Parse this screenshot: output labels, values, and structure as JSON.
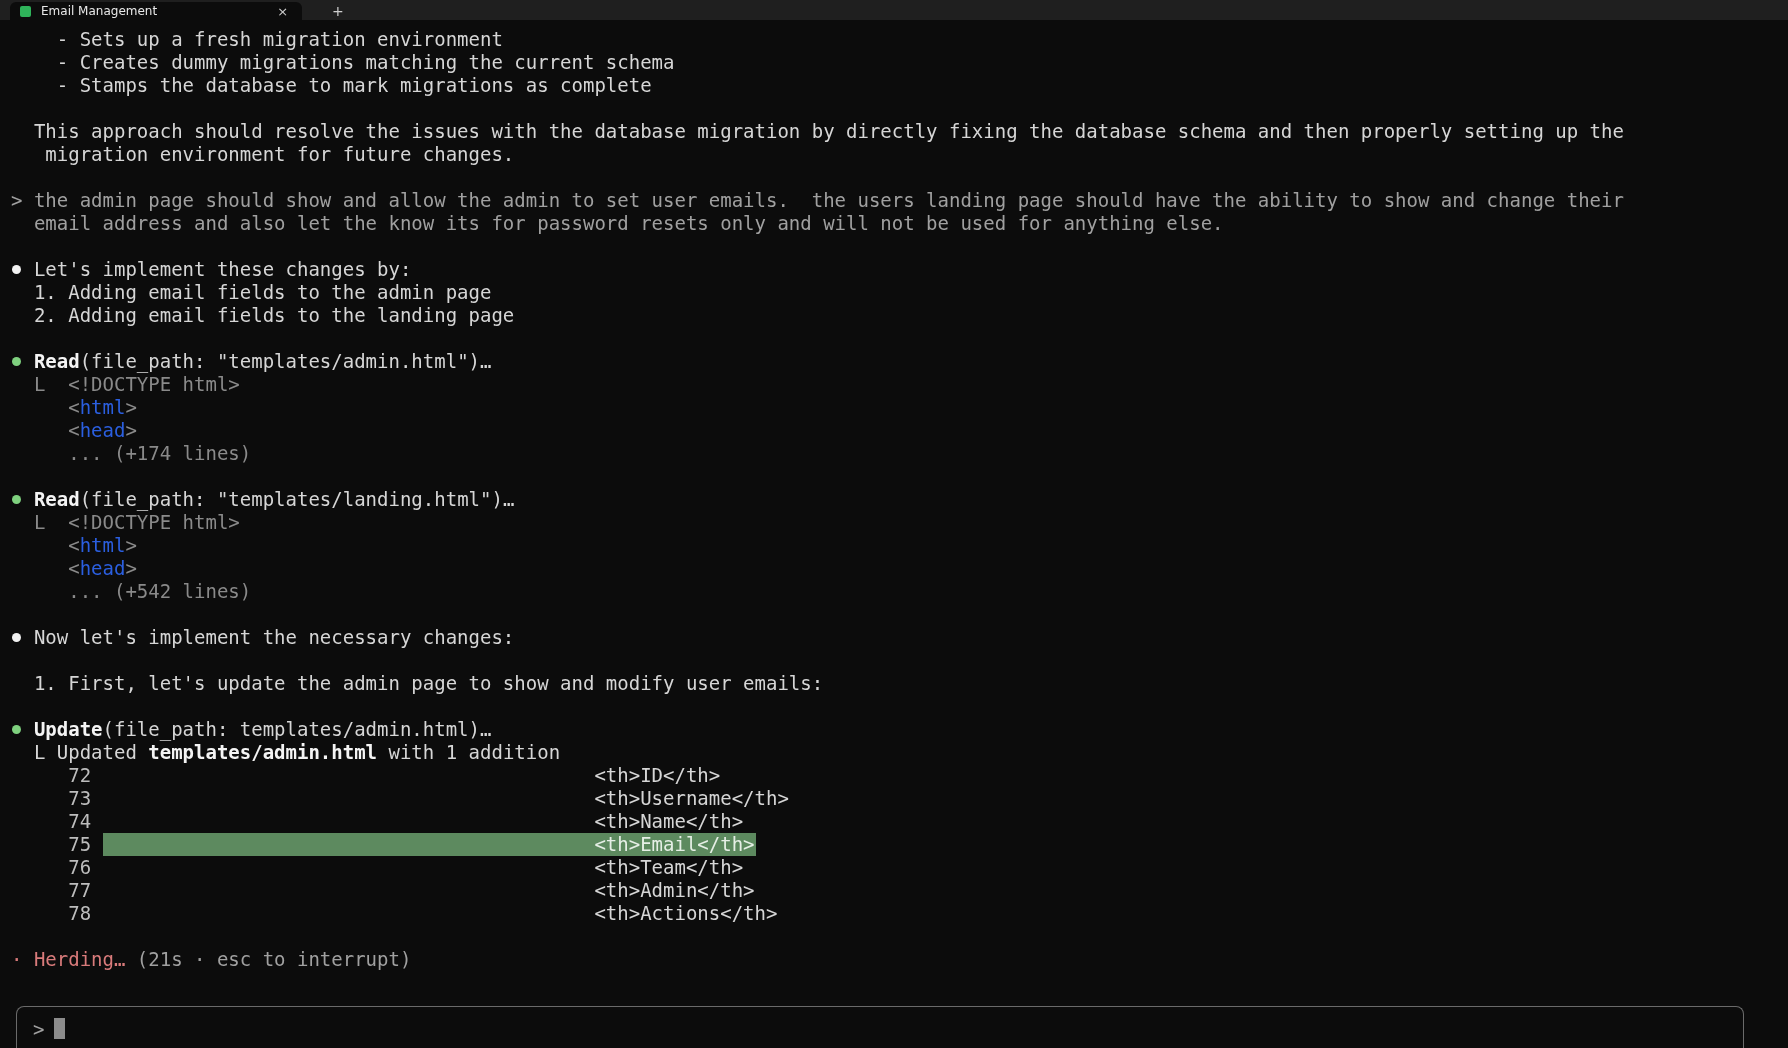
{
  "tab": {
    "title": "Email Management",
    "close": "×",
    "new_tab": "+"
  },
  "transcript": [
    {
      "kind": "list",
      "text": "- Sets up a fresh migration environment"
    },
    {
      "kind": "list",
      "text": "- Creates dummy migrations matching the current schema"
    },
    {
      "kind": "list",
      "text": "- Stamps the database to mark migrations as complete"
    },
    {
      "kind": "gap"
    },
    {
      "kind": "para",
      "text": "This approach should resolve the issues with the database migration by directly fixing the database schema and then properly setting up the"
    },
    {
      "kind": "para",
      "text": " migration environment for future changes."
    },
    {
      "kind": "gap"
    },
    {
      "kind": "user",
      "prompt": ">",
      "text": "the admin page should show and allow the admin to set user emails.  the users landing page should have the ability to show and change their"
    },
    {
      "kind": "user",
      "text": "email address and also let the know its for password resets only and will not be used for anything else."
    },
    {
      "kind": "gap"
    },
    {
      "kind": "bullet",
      "color": "#f2f2f2",
      "text": "Let's implement these changes by:"
    },
    {
      "kind": "para",
      "text": "1. Adding email fields to the admin page"
    },
    {
      "kind": "para",
      "text": "2. Adding email fields to the landing page"
    },
    {
      "kind": "gap"
    },
    {
      "kind": "bullet",
      "color": "#7fd17f",
      "text": "**Read**(file_path: \"templates/admin.html\")…"
    },
    {
      "kind": "output",
      "text": "L  <!DOCTYPE html>"
    },
    {
      "kind": "code",
      "parts": [
        {
          "kind": "plain",
          "text": "<"
        },
        {
          "kind": "tag",
          "text": "html"
        },
        {
          "kind": "plain",
          "text": ">"
        }
      ]
    },
    {
      "kind": "code",
      "parts": [
        {
          "kind": "plain",
          "text": "<"
        },
        {
          "kind": "tag",
          "text": "head"
        },
        {
          "kind": "plain",
          "text": ">"
        }
      ]
    },
    {
      "kind": "code",
      "parts": [
        {
          "kind": "plain",
          "text": "... (+174 lines)"
        }
      ]
    },
    {
      "kind": "gap"
    },
    {
      "kind": "bullet",
      "color": "#7fd17f",
      "text": "**Read**(file_path: \"templates/landing.html\")…"
    },
    {
      "kind": "output",
      "text": "L  <!DOCTYPE html>"
    },
    {
      "kind": "code",
      "parts": [
        {
          "kind": "plain",
          "text": "<"
        },
        {
          "kind": "tag",
          "text": "html"
        },
        {
          "kind": "plain",
          "text": ">"
        }
      ]
    },
    {
      "kind": "code",
      "parts": [
        {
          "kind": "plain",
          "text": "<"
        },
        {
          "kind": "tag",
          "text": "head"
        },
        {
          "kind": "plain",
          "text": ">"
        }
      ]
    },
    {
      "kind": "code",
      "parts": [
        {
          "kind": "plain",
          "text": "... (+542 lines)"
        }
      ]
    },
    {
      "kind": "gap"
    },
    {
      "kind": "bullet",
      "color": "#f2f2f2",
      "text": "Now let's implement the necessary changes:"
    },
    {
      "kind": "gap"
    },
    {
      "kind": "para",
      "text": "1. First, let's update the admin page to show and modify user emails:"
    },
    {
      "kind": "gap"
    },
    {
      "kind": "bullet",
      "color": "#7fd17f",
      "text": "**Update**(file_path: templates/admin.html)…"
    },
    {
      "kind": "diffhead",
      "text": "L Updated **templates/admin.html** with 1 addition"
    },
    {
      "kind": "diff",
      "number": "72",
      "code": "<th>ID</th>",
      "added": false
    },
    {
      "kind": "diff",
      "number": "73",
      "code": "<th>Username</th>",
      "added": false
    },
    {
      "kind": "diff",
      "number": "74",
      "code": "<th>Name</th>",
      "added": false
    },
    {
      "kind": "diff",
      "number": "75",
      "code": "<th>Email</th>",
      "added": true
    },
    {
      "kind": "diff",
      "number": "76",
      "code": "<th>Team</th>",
      "added": false
    },
    {
      "kind": "diff",
      "number": "77",
      "code": "<th>Admin</th>",
      "added": false
    },
    {
      "kind": "diff",
      "number": "78",
      "code": "<th>Actions</th>",
      "added": false
    },
    {
      "kind": "gap"
    },
    {
      "kind": "status",
      "marker": "·",
      "label": "Herding…",
      "detail": "(21s · esc to interrupt)"
    }
  ],
  "input": {
    "prompt": ">"
  }
}
